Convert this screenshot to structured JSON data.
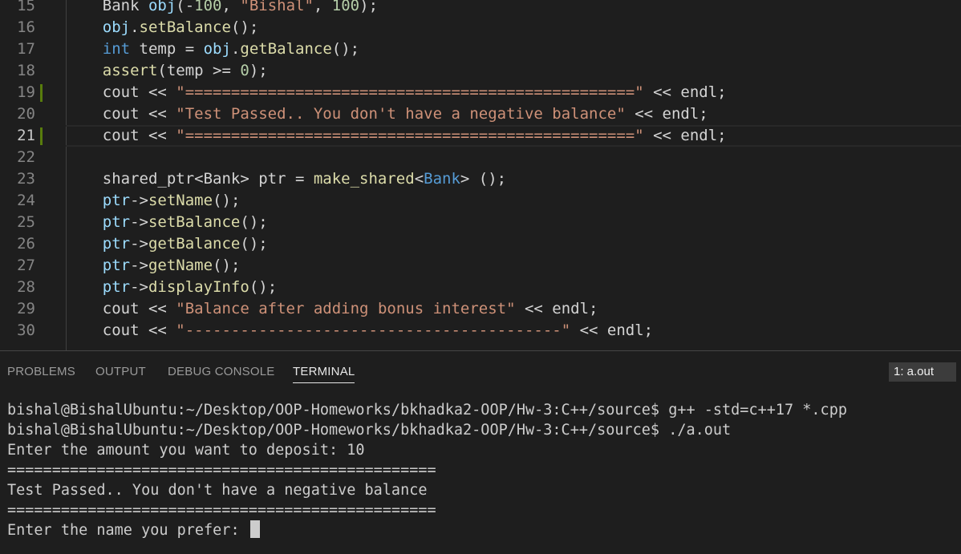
{
  "editor": {
    "lines": [
      {
        "num": "15",
        "tokens": [
          [
            "tok-plain",
            "    Bank "
          ],
          [
            "tok-var",
            "obj"
          ],
          [
            "tok-plain",
            "(-"
          ],
          [
            "tok-num",
            "100"
          ],
          [
            "tok-plain",
            ", "
          ],
          [
            "tok-str",
            "\"Bishal\""
          ],
          [
            "tok-plain",
            ", "
          ],
          [
            "tok-num",
            "100"
          ],
          [
            "tok-plain",
            ");"
          ]
        ]
      },
      {
        "num": "16",
        "tokens": [
          [
            "tok-plain",
            "    "
          ],
          [
            "tok-var",
            "obj"
          ],
          [
            "tok-plain",
            "."
          ],
          [
            "tok-fn",
            "setBalance"
          ],
          [
            "tok-plain",
            "();"
          ]
        ]
      },
      {
        "num": "17",
        "tokens": [
          [
            "tok-plain",
            "    "
          ],
          [
            "tok-keyword",
            "int"
          ],
          [
            "tok-plain",
            " temp = "
          ],
          [
            "tok-var",
            "obj"
          ],
          [
            "tok-plain",
            "."
          ],
          [
            "tok-fn",
            "getBalance"
          ],
          [
            "tok-plain",
            "();"
          ]
        ]
      },
      {
        "num": "18",
        "tokens": [
          [
            "tok-plain",
            "    "
          ],
          [
            "tok-fn",
            "assert"
          ],
          [
            "tok-plain",
            "(temp >= "
          ],
          [
            "tok-num",
            "0"
          ],
          [
            "tok-plain",
            ");"
          ]
        ]
      },
      {
        "num": "19",
        "modified": true,
        "tokens": [
          [
            "tok-plain",
            "    cout << "
          ],
          [
            "tok-str",
            "\"=================================================\""
          ],
          [
            "tok-plain",
            " << endl;"
          ]
        ]
      },
      {
        "num": "20",
        "tokens": [
          [
            "tok-plain",
            "    cout << "
          ],
          [
            "tok-str",
            "\"Test Passed.. You don't have a negative balance\""
          ],
          [
            "tok-plain",
            " << endl;"
          ]
        ]
      },
      {
        "num": "21",
        "modified": true,
        "current": true,
        "tokens": [
          [
            "tok-plain",
            "    cout << "
          ],
          [
            "tok-str",
            "\"=================================================\""
          ],
          [
            "tok-plain",
            " << endl;"
          ]
        ]
      },
      {
        "num": "22",
        "tokens": []
      },
      {
        "num": "23",
        "tokens": [
          [
            "tok-plain",
            "    shared_ptr<Bank> ptr = "
          ],
          [
            "tok-fn",
            "make_shared"
          ],
          [
            "tok-plain",
            "<"
          ],
          [
            "tok-keyword",
            "Bank"
          ],
          [
            "tok-plain",
            "> ();"
          ]
        ]
      },
      {
        "num": "24",
        "tokens": [
          [
            "tok-plain",
            "    "
          ],
          [
            "tok-var",
            "ptr"
          ],
          [
            "tok-plain",
            "->"
          ],
          [
            "tok-fn",
            "setName"
          ],
          [
            "tok-plain",
            "();"
          ]
        ]
      },
      {
        "num": "25",
        "tokens": [
          [
            "tok-plain",
            "    "
          ],
          [
            "tok-var",
            "ptr"
          ],
          [
            "tok-plain",
            "->"
          ],
          [
            "tok-fn",
            "setBalance"
          ],
          [
            "tok-plain",
            "();"
          ]
        ]
      },
      {
        "num": "26",
        "tokens": [
          [
            "tok-plain",
            "    "
          ],
          [
            "tok-var",
            "ptr"
          ],
          [
            "tok-plain",
            "->"
          ],
          [
            "tok-fn",
            "getBalance"
          ],
          [
            "tok-plain",
            "();"
          ]
        ]
      },
      {
        "num": "27",
        "tokens": [
          [
            "tok-plain",
            "    "
          ],
          [
            "tok-var",
            "ptr"
          ],
          [
            "tok-plain",
            "->"
          ],
          [
            "tok-fn",
            "getName"
          ],
          [
            "tok-plain",
            "();"
          ]
        ]
      },
      {
        "num": "28",
        "tokens": [
          [
            "tok-plain",
            "    "
          ],
          [
            "tok-var",
            "ptr"
          ],
          [
            "tok-plain",
            "->"
          ],
          [
            "tok-fn",
            "displayInfo"
          ],
          [
            "tok-plain",
            "();"
          ]
        ]
      },
      {
        "num": "29",
        "tokens": [
          [
            "tok-plain",
            "    cout << "
          ],
          [
            "tok-str",
            "\"Balance after adding bonus interest\""
          ],
          [
            "tok-plain",
            " << endl;"
          ]
        ]
      },
      {
        "num": "30",
        "tokens": [
          [
            "tok-plain",
            "    cout << "
          ],
          [
            "tok-str",
            "\"-----------------------------------------\""
          ],
          [
            "tok-plain",
            " << endl;"
          ]
        ]
      }
    ]
  },
  "panel": {
    "tabs": [
      {
        "label": "PROBLEMS",
        "active": false
      },
      {
        "label": "OUTPUT",
        "active": false
      },
      {
        "label": "DEBUG CONSOLE",
        "active": false
      },
      {
        "label": "TERMINAL",
        "active": true
      }
    ],
    "terminal_select": "1: a.out"
  },
  "terminal": {
    "lines": [
      "bishal@BishalUbuntu:~/Desktop/OOP-Homeworks/bkhadka2-OOP/Hw-3:C++/source$ g++ -std=c++17 *.cpp",
      "bishal@BishalUbuntu:~/Desktop/OOP-Homeworks/bkhadka2-OOP/Hw-3:C++/source$ ./a.out",
      "Enter the amount you want to deposit: 10",
      "================================================",
      "Test Passed.. You don't have a negative balance",
      "================================================",
      "Enter the name you prefer: "
    ]
  },
  "colors": {
    "background": "#1e1e1e",
    "keyword": "#569cd6",
    "variable": "#9cdcfe",
    "function": "#dcdcaa",
    "string": "#ce9178",
    "number": "#b5cea8",
    "git_modified": "#587c0c"
  }
}
